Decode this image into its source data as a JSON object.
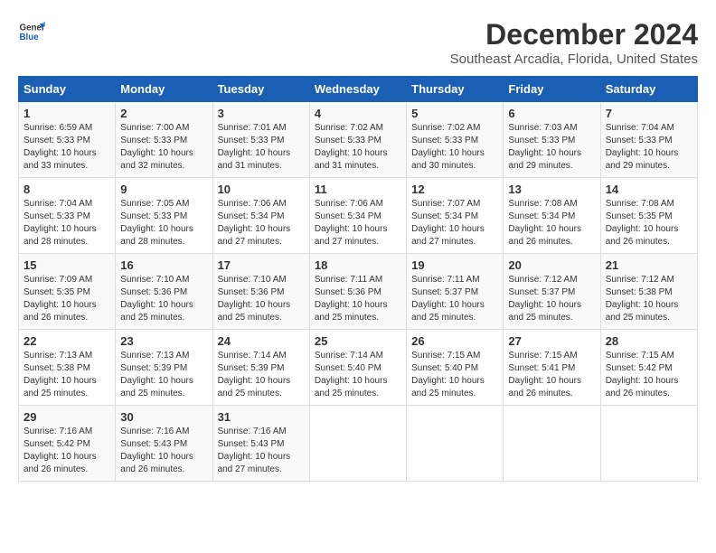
{
  "logo": {
    "line1": "General",
    "line2": "Blue"
  },
  "title": "December 2024",
  "subtitle": "Southeast Arcadia, Florida, United States",
  "days_of_week": [
    "Sunday",
    "Monday",
    "Tuesday",
    "Wednesday",
    "Thursday",
    "Friday",
    "Saturday"
  ],
  "weeks": [
    [
      {
        "day": "1",
        "sunrise": "6:59 AM",
        "sunset": "5:33 PM",
        "daylight": "10 hours and 33 minutes."
      },
      {
        "day": "2",
        "sunrise": "7:00 AM",
        "sunset": "5:33 PM",
        "daylight": "10 hours and 32 minutes."
      },
      {
        "day": "3",
        "sunrise": "7:01 AM",
        "sunset": "5:33 PM",
        "daylight": "10 hours and 31 minutes."
      },
      {
        "day": "4",
        "sunrise": "7:02 AM",
        "sunset": "5:33 PM",
        "daylight": "10 hours and 31 minutes."
      },
      {
        "day": "5",
        "sunrise": "7:02 AM",
        "sunset": "5:33 PM",
        "daylight": "10 hours and 30 minutes."
      },
      {
        "day": "6",
        "sunrise": "7:03 AM",
        "sunset": "5:33 PM",
        "daylight": "10 hours and 29 minutes."
      },
      {
        "day": "7",
        "sunrise": "7:04 AM",
        "sunset": "5:33 PM",
        "daylight": "10 hours and 29 minutes."
      }
    ],
    [
      {
        "day": "8",
        "sunrise": "7:04 AM",
        "sunset": "5:33 PM",
        "daylight": "10 hours and 28 minutes."
      },
      {
        "day": "9",
        "sunrise": "7:05 AM",
        "sunset": "5:33 PM",
        "daylight": "10 hours and 28 minutes."
      },
      {
        "day": "10",
        "sunrise": "7:06 AM",
        "sunset": "5:34 PM",
        "daylight": "10 hours and 27 minutes."
      },
      {
        "day": "11",
        "sunrise": "7:06 AM",
        "sunset": "5:34 PM",
        "daylight": "10 hours and 27 minutes."
      },
      {
        "day": "12",
        "sunrise": "7:07 AM",
        "sunset": "5:34 PM",
        "daylight": "10 hours and 27 minutes."
      },
      {
        "day": "13",
        "sunrise": "7:08 AM",
        "sunset": "5:34 PM",
        "daylight": "10 hours and 26 minutes."
      },
      {
        "day": "14",
        "sunrise": "7:08 AM",
        "sunset": "5:35 PM",
        "daylight": "10 hours and 26 minutes."
      }
    ],
    [
      {
        "day": "15",
        "sunrise": "7:09 AM",
        "sunset": "5:35 PM",
        "daylight": "10 hours and 26 minutes."
      },
      {
        "day": "16",
        "sunrise": "7:10 AM",
        "sunset": "5:36 PM",
        "daylight": "10 hours and 25 minutes."
      },
      {
        "day": "17",
        "sunrise": "7:10 AM",
        "sunset": "5:36 PM",
        "daylight": "10 hours and 25 minutes."
      },
      {
        "day": "18",
        "sunrise": "7:11 AM",
        "sunset": "5:36 PM",
        "daylight": "10 hours and 25 minutes."
      },
      {
        "day": "19",
        "sunrise": "7:11 AM",
        "sunset": "5:37 PM",
        "daylight": "10 hours and 25 minutes."
      },
      {
        "day": "20",
        "sunrise": "7:12 AM",
        "sunset": "5:37 PM",
        "daylight": "10 hours and 25 minutes."
      },
      {
        "day": "21",
        "sunrise": "7:12 AM",
        "sunset": "5:38 PM",
        "daylight": "10 hours and 25 minutes."
      }
    ],
    [
      {
        "day": "22",
        "sunrise": "7:13 AM",
        "sunset": "5:38 PM",
        "daylight": "10 hours and 25 minutes."
      },
      {
        "day": "23",
        "sunrise": "7:13 AM",
        "sunset": "5:39 PM",
        "daylight": "10 hours and 25 minutes."
      },
      {
        "day": "24",
        "sunrise": "7:14 AM",
        "sunset": "5:39 PM",
        "daylight": "10 hours and 25 minutes."
      },
      {
        "day": "25",
        "sunrise": "7:14 AM",
        "sunset": "5:40 PM",
        "daylight": "10 hours and 25 minutes."
      },
      {
        "day": "26",
        "sunrise": "7:15 AM",
        "sunset": "5:40 PM",
        "daylight": "10 hours and 25 minutes."
      },
      {
        "day": "27",
        "sunrise": "7:15 AM",
        "sunset": "5:41 PM",
        "daylight": "10 hours and 26 minutes."
      },
      {
        "day": "28",
        "sunrise": "7:15 AM",
        "sunset": "5:42 PM",
        "daylight": "10 hours and 26 minutes."
      }
    ],
    [
      {
        "day": "29",
        "sunrise": "7:16 AM",
        "sunset": "5:42 PM",
        "daylight": "10 hours and 26 minutes."
      },
      {
        "day": "30",
        "sunrise": "7:16 AM",
        "sunset": "5:43 PM",
        "daylight": "10 hours and 26 minutes."
      },
      {
        "day": "31",
        "sunrise": "7:16 AM",
        "sunset": "5:43 PM",
        "daylight": "10 hours and 27 minutes."
      },
      null,
      null,
      null,
      null
    ]
  ]
}
